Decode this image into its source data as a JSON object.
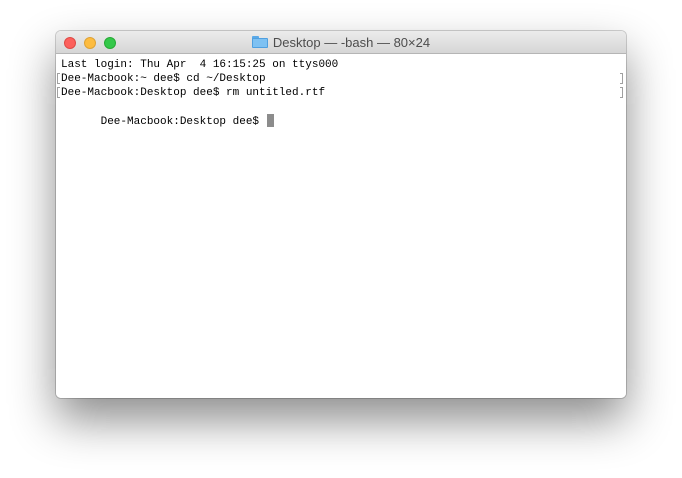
{
  "window": {
    "title": "Desktop — -bash — 80×24",
    "title_icon": "folder-icon"
  },
  "controls": {
    "close_color": "#fc605c",
    "minimize_color": "#fdbc40",
    "zoom_color": "#34c84a"
  },
  "terminal": {
    "lines": [
      "Last login: Thu Apr  4 16:15:25 on ttys000",
      "Dee-Macbook:~ dee$ cd ~/Desktop",
      "Dee-Macbook:Desktop dee$ rm untitled.rtf",
      "Dee-Macbook:Desktop dee$ "
    ]
  }
}
